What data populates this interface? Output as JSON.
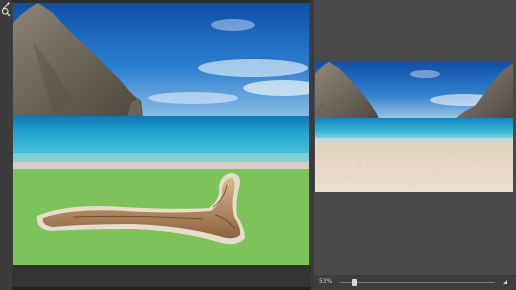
{
  "toolbar": {
    "tools": [
      {
        "icon": "magic-wand-icon"
      },
      {
        "icon": "zoom-icon"
      }
    ]
  },
  "canvas": {
    "image": "beach-cove-with-driftwood-on-green-masked-sand"
  },
  "preview": {
    "image": "beach-cove-with-filled-sand",
    "zoom_label": "53%",
    "zoom_level": 0.08
  },
  "colors": {
    "mask_overlay": "#7cc35a",
    "sea": "#2fb4d6",
    "sky": "#1f6fc4",
    "sand": "#e6d5c3",
    "panel_bg": "#4a4a4a"
  }
}
